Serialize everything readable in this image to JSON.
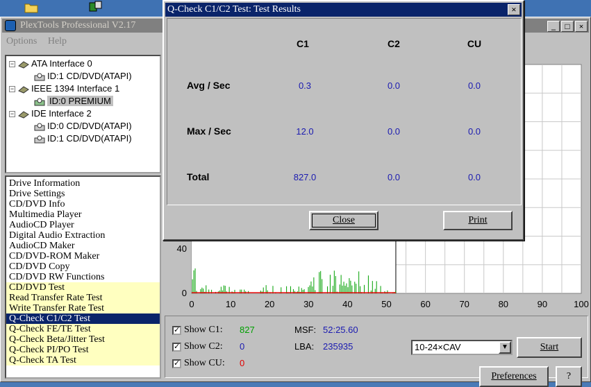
{
  "main_window": {
    "title": "PlexTools Professional V2.17",
    "menu": [
      "Options",
      "Help"
    ]
  },
  "tree": {
    "nodes": [
      {
        "label": "ATA Interface 0"
      },
      {
        "label": "ID:1  CD/DVD(ATAPI)"
      },
      {
        "label": "IEEE 1394 Interface 1"
      },
      {
        "label": "ID:0  PREMIUM"
      },
      {
        "label": "IDE Interface 2"
      },
      {
        "label": "ID:0  CD/DVD(ATAPI)"
      },
      {
        "label": "ID:1  CD/DVD(ATAPI)"
      }
    ]
  },
  "functions": [
    {
      "label": "Drive Information"
    },
    {
      "label": "Drive Settings"
    },
    {
      "label": "CD/DVD Info"
    },
    {
      "label": "Multimedia Player"
    },
    {
      "label": "AudioCD Player"
    },
    {
      "label": "Digital Audio Extraction"
    },
    {
      "label": "AudioCD Maker"
    },
    {
      "label": "CD/DVD-ROM Maker"
    },
    {
      "label": "CD/DVD Copy"
    },
    {
      "label": "CD/DVD RW Functions"
    },
    {
      "label": "CD/DVD Test"
    },
    {
      "label": "Read Transfer Rate Test"
    },
    {
      "label": "Write Transfer Rate Test"
    },
    {
      "label": "Q-Check C1/C2 Test"
    },
    {
      "label": "Q-Check FE/TE Test"
    },
    {
      "label": "Q-Check Beta/Jitter Test"
    },
    {
      "label": "Q-Check PI/PO Test"
    },
    {
      "label": "Q-Check TA Test"
    }
  ],
  "graph": {
    "y_ticks": [
      "40",
      "0"
    ],
    "x_ticks": [
      "0",
      "10",
      "20",
      "30",
      "40",
      "50",
      "60",
      "70",
      "80",
      "90",
      "100"
    ],
    "x_range": [
      0,
      100
    ],
    "y_range": [
      0,
      80
    ],
    "end_marker_x": 52.4,
    "c1_color": "#00a000",
    "c2_color": "#e00000"
  },
  "controls": {
    "show_c1": "Show C1:",
    "show_c2": "Show C2:",
    "show_cu": "Show CU:",
    "c1_value": "827",
    "c2_value": "0",
    "cu_value": "0",
    "msf_label": "MSF:",
    "msf_value": "52:25.60",
    "lba_label": "LBA:",
    "lba_value": "235935",
    "speed_value": "10-24×CAV",
    "start_label": "Start",
    "preferences_label": "Preferences",
    "help_label": "?"
  },
  "dialog": {
    "title": "Q-Check C1/C2 Test: Test Results",
    "columns": [
      "C1",
      "C2",
      "CU"
    ],
    "rows": [
      {
        "label": "Avg / Sec",
        "values": [
          "0.3",
          "0.0",
          "0.0"
        ]
      },
      {
        "label": "Max / Sec",
        "values": [
          "12.0",
          "0.0",
          "0.0"
        ]
      },
      {
        "label": "Total",
        "values": [
          "827.0",
          "0.0",
          "0.0"
        ]
      }
    ],
    "close_label": "Close",
    "print_label": "Print"
  }
}
